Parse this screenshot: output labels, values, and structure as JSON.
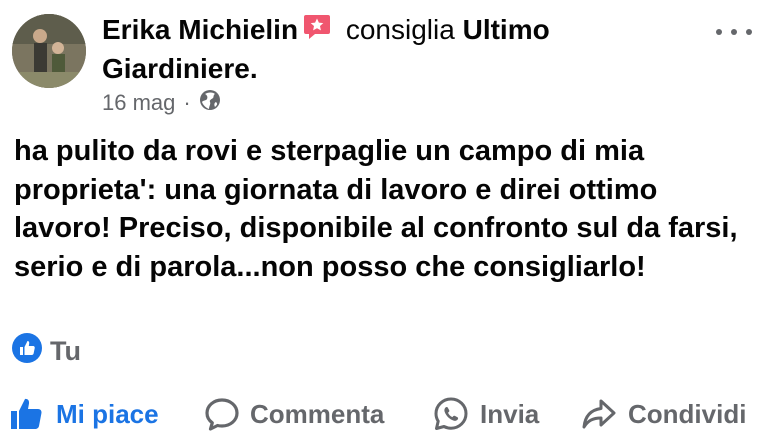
{
  "post": {
    "author": "Erika Michielin",
    "verb": "consiglia",
    "page_name_line1": "Ultimo",
    "page_name_line2": "Giardiniere.",
    "date": "16 mag",
    "separator": "·",
    "privacy_icon": "globe-icon",
    "recommend_icon": "recommend-star-icon",
    "text": "ha pulito da rovi e sterpaglie un campo di mia proprieta': una giornata di lavoro e direi ottimo lavoro! Preciso, disponibile al confronto sul da farsi, serio e di parola...non posso che consigliarlo!"
  },
  "reactions": {
    "icon": "like-icon",
    "label": "Tu"
  },
  "actions": {
    "like": "Mi piace",
    "comment": "Commenta",
    "send": "Invia",
    "share": "Condividi"
  },
  "colors": {
    "accent": "#1b74e4",
    "recommend": "#f0566f",
    "secondary_text": "#65676b"
  }
}
